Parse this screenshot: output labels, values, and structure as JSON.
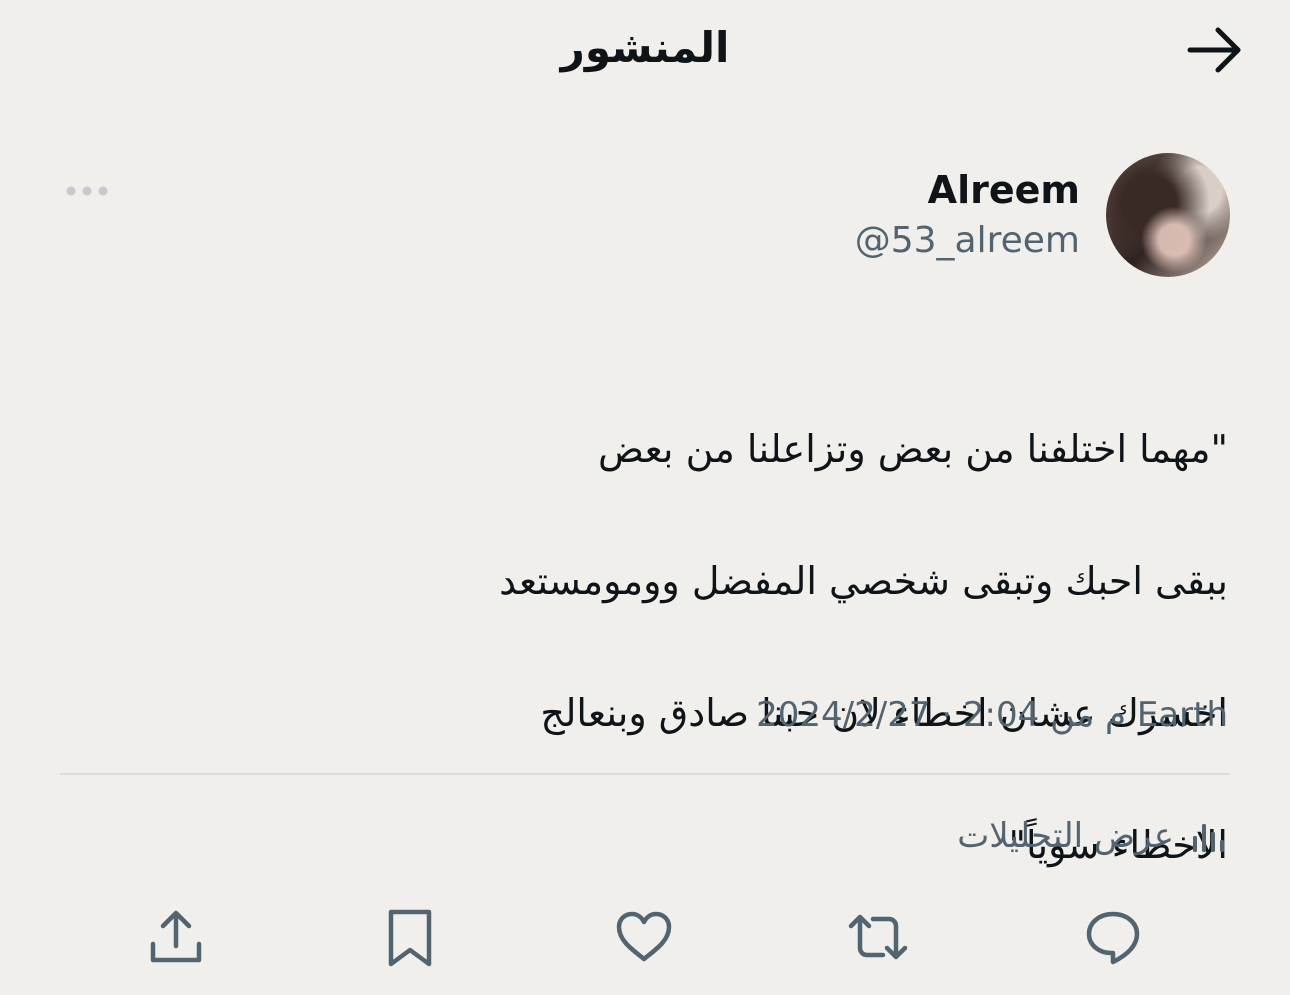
{
  "header": {
    "title": "المنشور",
    "back_icon": "arrow-right-icon"
  },
  "post": {
    "author": {
      "display_name": "Alreem",
      "handle": "@53_alreem"
    },
    "more_icon": "more-horizontal-icon",
    "body_lines": [
      "\"مهما اختلفنا من بعض وتزاعلنا من بعض",
      "ببقى احبك وتبقى  شخصي المفضل  وومومستعد",
      "اخسرك عشان اخطاء لان حبنا صادق وبنعالج",
      "الاخطاء سوياً\""
    ],
    "meta": "2024/2/27 · 2:04 م من Earth",
    "analytics_label": "عرض التحليلات"
  },
  "actions": [
    {
      "name": "reply",
      "icon": "reply-icon"
    },
    {
      "name": "repost",
      "icon": "repost-icon"
    },
    {
      "name": "like",
      "icon": "heart-icon"
    },
    {
      "name": "bookmark",
      "icon": "bookmark-icon"
    },
    {
      "name": "share",
      "icon": "share-icon"
    }
  ],
  "colors": {
    "background": "#f0efec",
    "text": "#0f1419",
    "secondary": "#536471",
    "divider": "#dcdcd8"
  }
}
